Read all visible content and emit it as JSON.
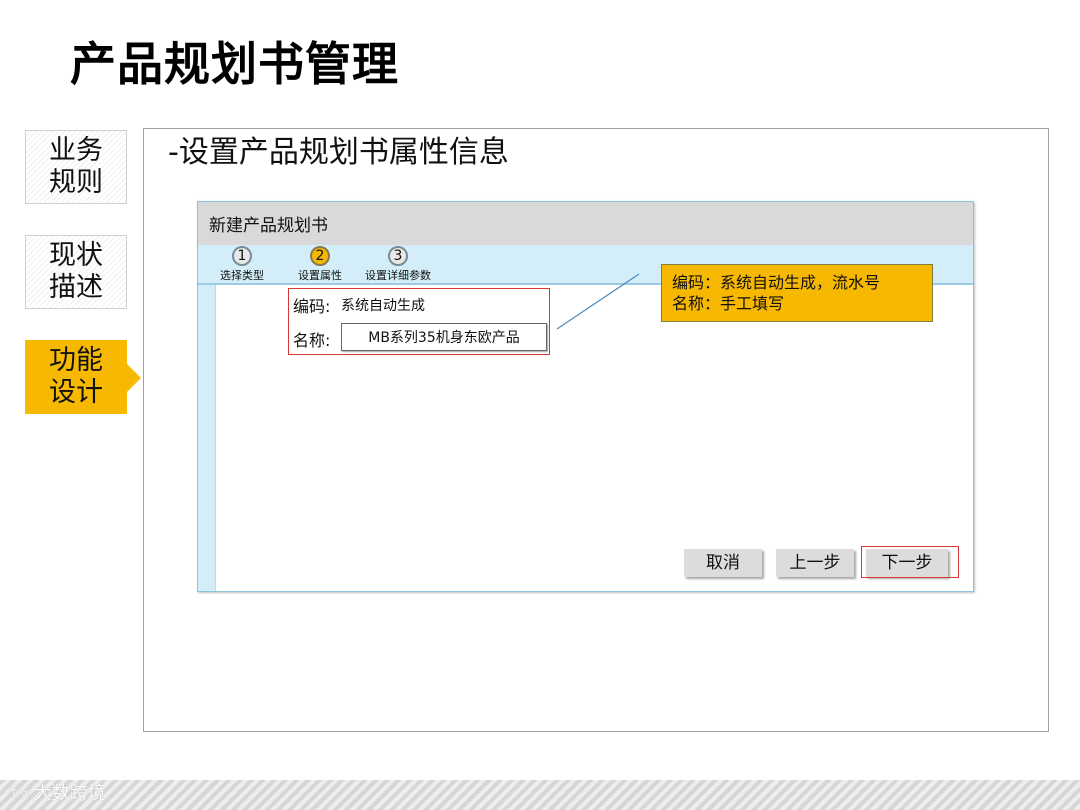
{
  "page": {
    "title": "产品规划书管理"
  },
  "side_tabs": [
    {
      "line1": "业务",
      "line2": "规则",
      "active": false
    },
    {
      "line1": "现状",
      "line2": "描述",
      "active": false
    },
    {
      "line1": "功能",
      "line2": "设计",
      "active": true
    }
  ],
  "section": {
    "title": "-设置产品规划书属性信息"
  },
  "dialog": {
    "title": "新建产品规划书",
    "steps": [
      {
        "num": "1",
        "label": "选择类型"
      },
      {
        "num": "2",
        "label": "设置属性",
        "current": true
      },
      {
        "num": "3",
        "label": "设置详细参数"
      }
    ],
    "form": {
      "code_label": "编码:",
      "code_value": "系统自动生成",
      "name_label": "名称:",
      "name_value": "MB系列35机身东欧产品"
    },
    "buttons": {
      "cancel": "取消",
      "prev": "上一步",
      "next": "下一步"
    }
  },
  "callout": {
    "line1": "编码：系统自动生成，流水号",
    "line2": "名称：手工填写"
  },
  "footer": {
    "logo_mark": "ⓒ∞",
    "logo_text": "大数跨境"
  },
  "colors": {
    "accent": "#f6b800",
    "highlight": "#d43a3a",
    "dialog_blue": "#d4eef9"
  }
}
